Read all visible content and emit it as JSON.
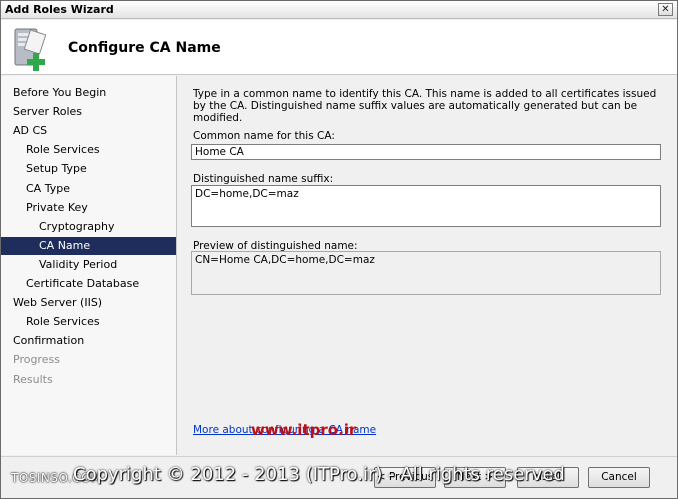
{
  "window": {
    "title": "Add Roles Wizard"
  },
  "header": {
    "title": "Configure CA Name"
  },
  "nav": {
    "items": [
      {
        "label": "Before You Begin",
        "indent": 0,
        "state": "normal"
      },
      {
        "label": "Server Roles",
        "indent": 0,
        "state": "normal"
      },
      {
        "label": "AD CS",
        "indent": 0,
        "state": "normal"
      },
      {
        "label": "Role Services",
        "indent": 1,
        "state": "normal"
      },
      {
        "label": "Setup Type",
        "indent": 1,
        "state": "normal"
      },
      {
        "label": "CA Type",
        "indent": 1,
        "state": "normal"
      },
      {
        "label": "Private Key",
        "indent": 1,
        "state": "normal"
      },
      {
        "label": "Cryptography",
        "indent": 2,
        "state": "normal"
      },
      {
        "label": "CA Name",
        "indent": 2,
        "state": "selected"
      },
      {
        "label": "Validity Period",
        "indent": 2,
        "state": "normal"
      },
      {
        "label": "Certificate Database",
        "indent": 1,
        "state": "normal"
      },
      {
        "label": "Web Server (IIS)",
        "indent": 0,
        "state": "normal"
      },
      {
        "label": "Role Services",
        "indent": 1,
        "state": "normal"
      },
      {
        "label": "Confirmation",
        "indent": 0,
        "state": "normal"
      },
      {
        "label": "Progress",
        "indent": 0,
        "state": "disabled"
      },
      {
        "label": "Results",
        "indent": 0,
        "state": "disabled"
      }
    ]
  },
  "content": {
    "description": "Type in a common name to identify this CA. This name is added to all certificates issued by the CA. Distinguished name suffix values are automatically generated but can be modified.",
    "common_name_label": "Common name for this CA:",
    "common_name_value": "Home CA",
    "dn_suffix_label": "Distinguished name suffix:",
    "dn_suffix_value": "DC=home,DC=maz",
    "preview_label": "Preview of distinguished name:",
    "preview_value": "CN=Home CA,DC=home,DC=maz",
    "more_link": "More about configuring a CA name"
  },
  "footer": {
    "previous_label": "< Previous",
    "next_label": "Next >",
    "install_label": "Install",
    "cancel_label": "Cancel"
  },
  "watermark": {
    "url": "www.itpro.ir",
    "left_text": "TOSINSO.COM",
    "copyright": "Copyright © 2012 - 2013 (ITPro.ir) - All rights reserved"
  },
  "colors": {
    "selected_nav_bg": "#1e2d5c",
    "link": "#0033cc",
    "watermark_red": "#b8121b"
  }
}
